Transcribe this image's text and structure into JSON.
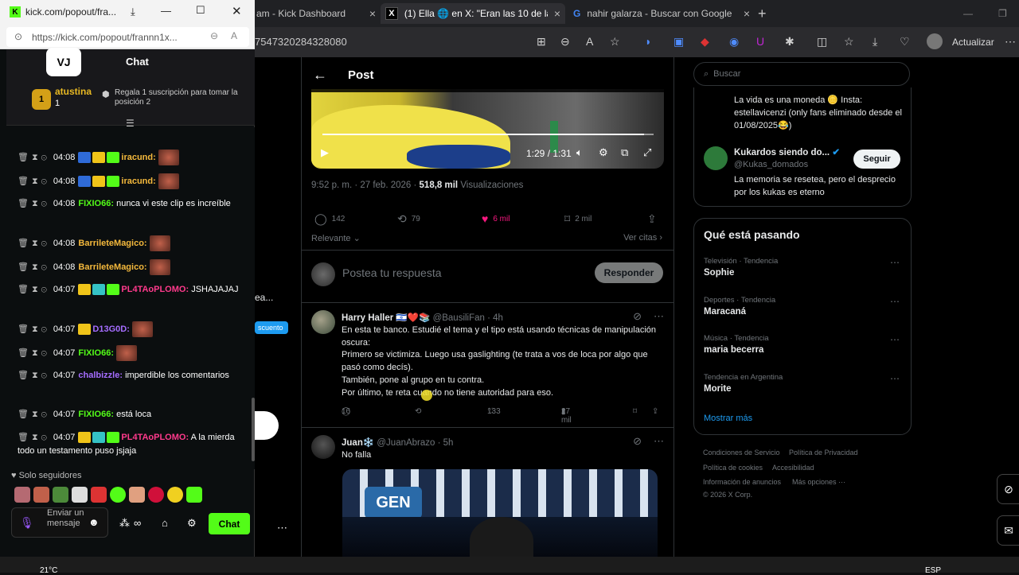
{
  "browser": {
    "tabs": [
      {
        "label": "am - Kick Dashboard",
        "close": "×"
      },
      {
        "label": "(1) Ella 🌐 en X: \"Eran las 10 de la n",
        "close": "×"
      },
      {
        "label": "nahir galarza - Buscar con Google",
        "close": "×"
      }
    ],
    "new_tab": "+",
    "url": "7547320284328080",
    "update_label": "Actualizar"
  },
  "popout": {
    "title": "kick.com/popout/fra...",
    "url": "https://kick.com/popout/frannn1x...",
    "chat_title": "Chat",
    "logo": "VJ",
    "pinned": {
      "rank": "1",
      "user": "atustina",
      "count": "1",
      "message": "Regala 1 suscripción para tomar la posición 2"
    },
    "messages": [
      {
        "time": "04:08",
        "user": "iracund:",
        "text": "",
        "color": "u-orange"
      },
      {
        "time": "04:08",
        "user": "iracund:",
        "text": "",
        "color": "u-orange"
      },
      {
        "time": "04:08",
        "user": "FIXIO66:",
        "text": "nunca vi este clip es increíble",
        "color": "u-green"
      },
      {
        "time": "04:08",
        "user": "BarrileteMagico:",
        "text": "",
        "color": "u-orange"
      },
      {
        "time": "04:08",
        "user": "BarrileteMagico:",
        "text": "",
        "color": "u-orange"
      },
      {
        "time": "04:07",
        "user": "PL4TAoPLOMO:",
        "text": "JSHAJAJAJ",
        "color": "u-pink"
      },
      {
        "time": "04:07",
        "user": "D13G0D:",
        "text": "",
        "color": "u-purple"
      },
      {
        "time": "04:07",
        "user": "FIXIO66:",
        "text": "",
        "color": "u-green"
      },
      {
        "time": "04:07",
        "user": "chalbizzle:",
        "text": "imperdible los comentarios",
        "color": "u-purple"
      },
      {
        "time": "04:07",
        "user": "FIXIO66:",
        "text": "está loca",
        "color": "u-green"
      },
      {
        "time": "04:07",
        "user": "PL4TAoPLOMO:",
        "text": "A la mierda todo un testamento puso jsjaja",
        "color": "u-pink"
      }
    ],
    "followers_only": "Solo seguidores",
    "input_placeholder": "Enviar un mensaje",
    "send_label": "Chat"
  },
  "x": {
    "left_fragment": "ea...",
    "left_badge": "scuento",
    "post_title": "Post",
    "video_time": "1:29 / 1:31",
    "video_progress": 0.97,
    "timestamp": "9:52 p. m. · 27 feb. 2026 · ",
    "views": "518,8 mil",
    "views_label": " Visualizaciones",
    "stats": {
      "replies": "142",
      "reposts": "79",
      "likes": "6 mil",
      "bookmarks": "2 mil"
    },
    "relevant": "Relevante",
    "quotes": "Ver citas",
    "reply_placeholder": "Postea tu respuesta",
    "reply_button": "Responder",
    "tweets": [
      {
        "name": "Harry Haller 🇮🇱❤️📚",
        "handle": "@BausiliFan · 4h",
        "lines": [
          "En esta te banco. Estudié el tema y el tipo está usando técnicas de manipulación oscura:",
          "Primero se victimiza. Luego usa gaslighting (te trata a vos de loca por algo que pasó como decís).",
          "También, pone al grupo en tu contra.",
          "Por último, te reta cuando no tiene autoridad para eso."
        ],
        "replies": "16",
        "likes": "133",
        "views": "27 mil"
      },
      {
        "name": "Juan❄️",
        "handle": "@JuanAbrazo · 5h",
        "lines": [
          "No falla"
        ],
        "image_label": "GEN"
      }
    ],
    "sidebar": {
      "search_placeholder": "Buscar",
      "top_text": "La vida es una moneda 🪙 Insta: estellavicenzi (only fans eliminado desde el 01/08/2025😂)",
      "suggest_name": "Kukardos siendo do...",
      "suggest_handle": "@Kukas_domados",
      "suggest_bio": "La memoria se resetea, pero el desprecio por los kukas es eterno",
      "follow_label": "Seguir",
      "trends_title": "Qué está pasando",
      "trends": [
        {
          "category": "Televisión · Tendencia",
          "name": "Sophie"
        },
        {
          "category": "Deportes · Tendencia",
          "name": "Maracaná"
        },
        {
          "category": "Música · Tendencia",
          "name": "maria becerra"
        },
        {
          "category": "Tendencia en Argentina",
          "name": "Morite"
        }
      ],
      "show_more": "Mostrar más",
      "footer": [
        "Condiciones de Servicio",
        "Política de Privacidad",
        "Política de cookies",
        "Accesibilidad",
        "Información de anuncios",
        "Más opciones ···",
        "© 2026 X Corp."
      ]
    }
  },
  "taskbar": {
    "temperature": "21°C",
    "lang": "ESP"
  }
}
